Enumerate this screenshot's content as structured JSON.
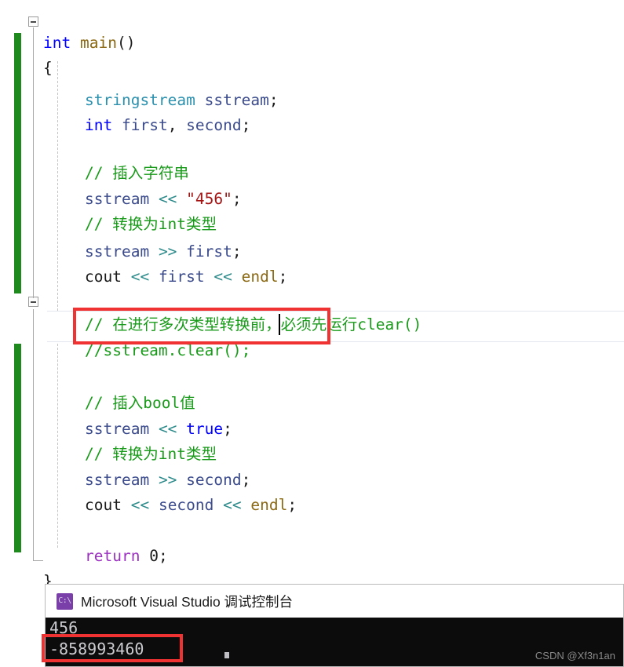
{
  "editor": {
    "language": "cpp",
    "change_bar_color": "#1e8a1e",
    "annotation_color": "#f03232",
    "lines": [
      {
        "n": 1,
        "indent": 0,
        "text": "int main()"
      },
      {
        "n": 2,
        "indent": 1,
        "text": "{"
      },
      {
        "n": 3,
        "indent": 2,
        "text": "stringstream sstream;"
      },
      {
        "n": 4,
        "indent": 2,
        "text": "int first, second;"
      },
      {
        "n": 5,
        "indent": 0,
        "text": ""
      },
      {
        "n": 6,
        "indent": 2,
        "text": "// 插入字符串"
      },
      {
        "n": 7,
        "indent": 2,
        "text": "sstream << \"456\";"
      },
      {
        "n": 8,
        "indent": 2,
        "text": "// 转换为int类型"
      },
      {
        "n": 9,
        "indent": 2,
        "text": "sstream >> first;"
      },
      {
        "n": 10,
        "indent": 2,
        "text": "cout << first << endl;"
      },
      {
        "n": 11,
        "indent": 0,
        "text": ""
      },
      {
        "n": 12,
        "indent": 2,
        "text": "// 在进行多次类型转换前，必须先运行clear()"
      },
      {
        "n": 13,
        "indent": 2,
        "text": "//sstream.clear();"
      },
      {
        "n": 14,
        "indent": 0,
        "text": ""
      },
      {
        "n": 15,
        "indent": 2,
        "text": "// 插入bool值"
      },
      {
        "n": 16,
        "indent": 2,
        "text": "sstream << true;"
      },
      {
        "n": 17,
        "indent": 2,
        "text": "// 转换为int类型"
      },
      {
        "n": 18,
        "indent": 2,
        "text": "sstream >> second;"
      },
      {
        "n": 19,
        "indent": 2,
        "text": "cout << second << endl;"
      },
      {
        "n": 20,
        "indent": 0,
        "text": ""
      },
      {
        "n": 21,
        "indent": 2,
        "text": "return 0;"
      },
      {
        "n": 22,
        "indent": 1,
        "text": "}"
      }
    ],
    "tokens": {
      "l1": [
        {
          "t": "int",
          "c": "t-keyword"
        },
        {
          "t": " ",
          "c": "t-plain"
        },
        {
          "t": "main",
          "c": "t-func"
        },
        {
          "t": "()",
          "c": "t-plain"
        }
      ],
      "l2": [
        {
          "t": "{",
          "c": "t-plain"
        }
      ],
      "l3": [
        {
          "t": "stringstream",
          "c": "t-type"
        },
        {
          "t": " ",
          "c": "t-plain"
        },
        {
          "t": "sstream",
          "c": "t-var"
        },
        {
          "t": ";",
          "c": "t-plain"
        }
      ],
      "l4": [
        {
          "t": "int",
          "c": "t-keyword"
        },
        {
          "t": " ",
          "c": "t-plain"
        },
        {
          "t": "first",
          "c": "t-var"
        },
        {
          "t": ", ",
          "c": "t-plain"
        },
        {
          "t": "second",
          "c": "t-var"
        },
        {
          "t": ";",
          "c": "t-plain"
        }
      ],
      "l6": [
        {
          "t": "// 插入字符串",
          "c": "t-comment"
        }
      ],
      "l7": [
        {
          "t": "sstream",
          "c": "t-var"
        },
        {
          "t": " ",
          "c": "t-plain"
        },
        {
          "t": "<<",
          "c": "t-op"
        },
        {
          "t": " ",
          "c": "t-plain"
        },
        {
          "t": "\"456\"",
          "c": "t-string"
        },
        {
          "t": ";",
          "c": "t-plain"
        }
      ],
      "l8": [
        {
          "t": "// 转换为int类型",
          "c": "t-comment"
        }
      ],
      "l9": [
        {
          "t": "sstream",
          "c": "t-var"
        },
        {
          "t": " ",
          "c": "t-plain"
        },
        {
          "t": ">>",
          "c": "t-op"
        },
        {
          "t": " ",
          "c": "t-plain"
        },
        {
          "t": "first",
          "c": "t-var"
        },
        {
          "t": ";",
          "c": "t-plain"
        }
      ],
      "l10": [
        {
          "t": "cout",
          "c": "t-plain"
        },
        {
          "t": " ",
          "c": "t-plain"
        },
        {
          "t": "<<",
          "c": "t-op"
        },
        {
          "t": " ",
          "c": "t-plain"
        },
        {
          "t": "first",
          "c": "t-var"
        },
        {
          "t": " ",
          "c": "t-plain"
        },
        {
          "t": "<<",
          "c": "t-op"
        },
        {
          "t": " ",
          "c": "t-plain"
        },
        {
          "t": "endl",
          "c": "t-macro"
        },
        {
          "t": ";",
          "c": "t-plain"
        }
      ],
      "l12": [
        {
          "t": "// 在进行多次类型转换前，必须先运行clear()",
          "c": "t-comment"
        }
      ],
      "l13": [
        {
          "t": "//sstream.clear();",
          "c": "t-comment"
        }
      ],
      "l15": [
        {
          "t": "// 插入bool值",
          "c": "t-comment"
        }
      ],
      "l16": [
        {
          "t": "sstream",
          "c": "t-var"
        },
        {
          "t": " ",
          "c": "t-plain"
        },
        {
          "t": "<<",
          "c": "t-op"
        },
        {
          "t": " ",
          "c": "t-plain"
        },
        {
          "t": "true",
          "c": "t-keyword"
        },
        {
          "t": ";",
          "c": "t-plain"
        }
      ],
      "l17": [
        {
          "t": "// 转换为int类型",
          "c": "t-comment"
        }
      ],
      "l18": [
        {
          "t": "sstream",
          "c": "t-var"
        },
        {
          "t": " ",
          "c": "t-plain"
        },
        {
          "t": ">>",
          "c": "t-op"
        },
        {
          "t": " ",
          "c": "t-plain"
        },
        {
          "t": "second",
          "c": "t-var"
        },
        {
          "t": ";",
          "c": "t-plain"
        }
      ],
      "l19": [
        {
          "t": "cout",
          "c": "t-plain"
        },
        {
          "t": " ",
          "c": "t-plain"
        },
        {
          "t": "<<",
          "c": "t-op"
        },
        {
          "t": " ",
          "c": "t-plain"
        },
        {
          "t": "second",
          "c": "t-var"
        },
        {
          "t": " ",
          "c": "t-plain"
        },
        {
          "t": "<<",
          "c": "t-op"
        },
        {
          "t": " ",
          "c": "t-plain"
        },
        {
          "t": "endl",
          "c": "t-macro"
        },
        {
          "t": ";",
          "c": "t-plain"
        }
      ],
      "l21": [
        {
          "t": "return",
          "c": "t-ret"
        },
        {
          "t": " ",
          "c": "t-plain"
        },
        {
          "t": "0",
          "c": "t-num"
        },
        {
          "t": ";",
          "c": "t-plain"
        }
      ],
      "l22": [
        {
          "t": "}",
          "c": "t-plain"
        }
      ]
    }
  },
  "console": {
    "title": "Microsoft Visual Studio 调试控制台",
    "icon_label": "C:\\",
    "output_lines": [
      "456",
      "-858993460"
    ],
    "background": "#0c0c0c",
    "text_color": "#ccccd0"
  },
  "watermark": {
    "text": "CSDN @Xf3n1an"
  }
}
